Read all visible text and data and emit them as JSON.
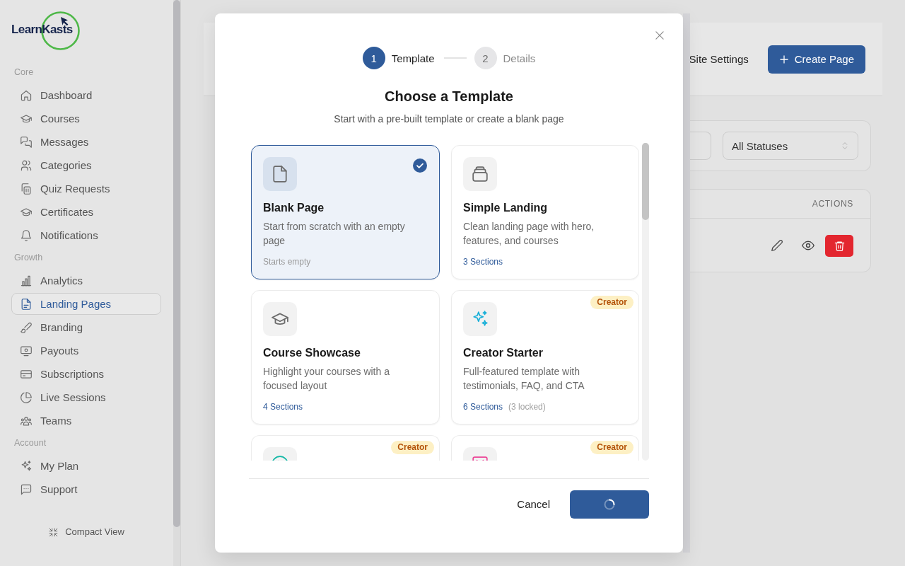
{
  "sidebar": {
    "logo": "LearnKasts",
    "sections": [
      {
        "label": "Core",
        "items": [
          {
            "label": "Dashboard",
            "selected": false
          },
          {
            "label": "Courses",
            "selected": false
          },
          {
            "label": "Messages",
            "selected": false
          },
          {
            "label": "Categories",
            "selected": false
          },
          {
            "label": "Quiz Requests",
            "selected": false
          },
          {
            "label": "Certificates",
            "selected": false
          },
          {
            "label": "Notifications",
            "selected": false
          }
        ]
      },
      {
        "label": "Growth",
        "items": [
          {
            "label": "Analytics",
            "selected": false
          },
          {
            "label": "Landing Pages",
            "selected": true
          },
          {
            "label": "Branding",
            "selected": false
          },
          {
            "label": "Payouts",
            "selected": false
          },
          {
            "label": "Subscriptions",
            "selected": false
          },
          {
            "label": "Live Sessions",
            "selected": false
          },
          {
            "label": "Teams",
            "selected": false
          }
        ]
      },
      {
        "label": "Account",
        "items": [
          {
            "label": "My Plan",
            "selected": false
          },
          {
            "label": "Support",
            "selected": false
          }
        ]
      }
    ],
    "compact_view": "Compact View"
  },
  "header": {
    "site_settings": "Site Settings",
    "create_button": "Create Page"
  },
  "filters": {
    "status_select": "All Statuses"
  },
  "table": {
    "columns": [
      "ACTIONS"
    ]
  },
  "modal": {
    "steps": [
      {
        "number": "1",
        "label": "Template",
        "selected": true
      },
      {
        "number": "2",
        "label": "Details",
        "selected": false
      }
    ],
    "title": "Choose a Template",
    "subtitle": "Start with a pre-built template or create a blank page",
    "templates": [
      {
        "title": "Blank Page",
        "description": "Start from scratch with an empty page",
        "note": "Starts empty",
        "selected": true
      },
      {
        "title": "Simple Landing",
        "description": "Clean landing page with hero, features, and courses",
        "sections": "3 Sections",
        "selected": false
      },
      {
        "title": "Course Showcase",
        "description": "Highlight your courses with a focused layout",
        "sections": "4 Sections",
        "selected": false
      },
      {
        "title": "Creator Starter",
        "description": "Full-featured template with testimonials, FAQ, and CTA",
        "sections": "6 Sections",
        "locked": "(3 locked)",
        "badge": "Creator",
        "selected": false
      },
      {
        "badge": "Creator",
        "selected": false
      },
      {
        "badge": "Creator",
        "selected": false
      }
    ],
    "cancel": "Cancel",
    "primary_button": {
      "loading": true
    }
  }
}
